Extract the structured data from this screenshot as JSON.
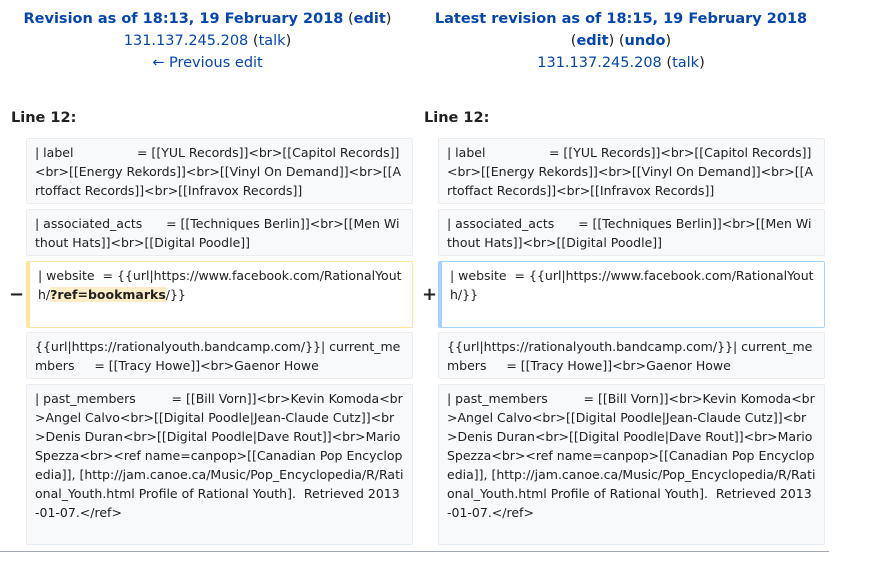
{
  "left_header": {
    "title": "Revision as of 18:13, 19 February 2018",
    "edit_label": "edit",
    "user": "131.137.245.208",
    "talk_label": "talk",
    "prev_edit": "← Previous edit"
  },
  "right_header": {
    "title": "Latest revision as of 18:15, 19 February 2018",
    "edit_label": "edit",
    "undo_label": "undo",
    "user": "131.137.245.208",
    "talk_label": "talk"
  },
  "left_line_label": "Line 12:",
  "right_line_label": "Line 12:",
  "rows": [
    {
      "text": "| label                = [[YUL Records]]<br>[[Capitol Records]]<br>[[Energy Rekords]]<br>[[Vinyl On Demand]]<br>[[Artoffact Records]]<br>[[Infravox Records]]"
    },
    {
      "text": "| associated_acts      = [[Techniques Berlin]]<br>[[Men Without Hats]]<br>[[Digital Poodle]]"
    },
    {
      "text": "{{url|https://rationalyouth.bandcamp.com/}}| current_members     = [[Tracy Howe]]<br>Gaenor Howe"
    },
    {
      "text": "| past_members         = [[Bill Vorn]]<br>Kevin Komoda<br>Angel Calvo<br>[[Digital Poodle|Jean-Claude Cutz]]<br>Denis Duran<br>[[Digital Poodle|Dave Rout]]<br>Mario Spezza<br><ref name=canpop>[[Canadian Pop Encyclopedia]], [http://jam.canoe.ca/Music/Pop_Encyclopedia/R/Rational_Youth.html Profile of Rational Youth].  Retrieved 2013-01-07.</ref>"
    }
  ],
  "changed": {
    "del_marker": "−",
    "add_marker": "+",
    "del_before": "| website  = {{url|https://www.facebook.com/RationalYouth/",
    "del_highlight": "?ref=bookmarks",
    "del_after": "/}}",
    "add_text": "| website  = {{url|https://www.facebook.com/RationalYouth/}}"
  }
}
